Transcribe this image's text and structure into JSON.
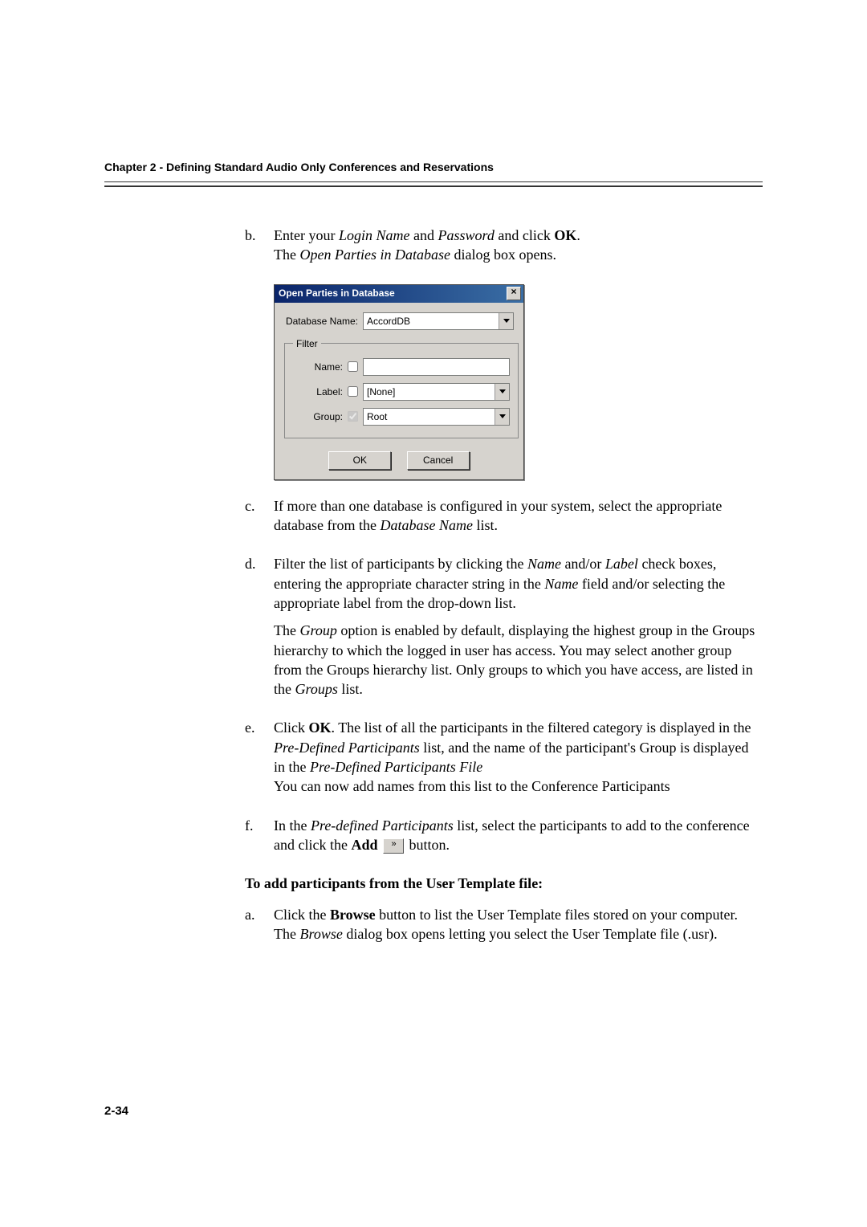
{
  "header": {
    "chapter_title": "Chapter 2 - Defining Standard Audio Only Conferences and Reservations"
  },
  "steps_b": {
    "letter": "b.",
    "line1_pre": "Enter your ",
    "italic1": "Login Name",
    "mid1": " and ",
    "italic2": "Password",
    "mid2": " and click ",
    "bold1": "OK",
    "post1": ".",
    "line2_pre": "The ",
    "italic3": "Open Parties in Database",
    "line2_post": " dialog box opens."
  },
  "dialog": {
    "title": "Open Parties in Database",
    "db_label": "Database Name:",
    "db_value": "AccordDB",
    "filter_legend": "Filter",
    "name_label": "Name:",
    "name_value": "",
    "label_label": "Label:",
    "label_value": "[None]",
    "group_label": "Group:",
    "group_value": "Root",
    "ok": "OK",
    "cancel": "Cancel"
  },
  "steps_c": {
    "letter": "c.",
    "pre": "If more than one database is configured in your system, select the appropriate database from the ",
    "italic": "Database Name",
    "post": " list."
  },
  "steps_d": {
    "letter": "d.",
    "p1_a": "Filter the list of participants by clicking the ",
    "p1_i1": "Name",
    "p1_b": " and/or ",
    "p1_i2": "Label",
    "p1_c": " check boxes, entering the appropriate character string in the ",
    "p1_i3": "Name",
    "p1_d": " field and/or selecting the appropriate label from the drop-down list.",
    "p2_a": "The ",
    "p2_i1": "Group",
    "p2_b": " option is enabled by default, displaying the highest group in the Groups hierarchy to which the logged in user has access. You may select another group from the Groups hierarchy list. Only groups to which you have access, are listed in the ",
    "p2_i2": "Groups",
    "p2_c": " list."
  },
  "steps_e": {
    "letter": "e.",
    "a": "Click ",
    "b1": "OK",
    "b": ". The list of all the participants in the filtered category is displayed in the ",
    "i1": "Pre-Defined Participants",
    "c": " list, and the name of the participant's Group is displayed in the ",
    "i2": "Pre-Defined Participants File",
    "line2": "You can now add names from this list to the Conference Participants"
  },
  "steps_f": {
    "letter": "f.",
    "a": "In the ",
    "i1": "Pre-defined Participants",
    "b": " list, select the participants to add to the conference and click the ",
    "bold": "Add",
    "btn_glyph": "»",
    "c": " button."
  },
  "subhead": "To add participants from the User Template file:",
  "steps_a2": {
    "letter": "a.",
    "a": "Click the ",
    "bold": "Browse",
    "b": " button to list the User Template files stored on your computer.",
    "line2a": "The ",
    "i1": "Browse",
    "line2b": " dialog box opens letting you select the User Template file (.usr)."
  },
  "page_number": "2-34"
}
